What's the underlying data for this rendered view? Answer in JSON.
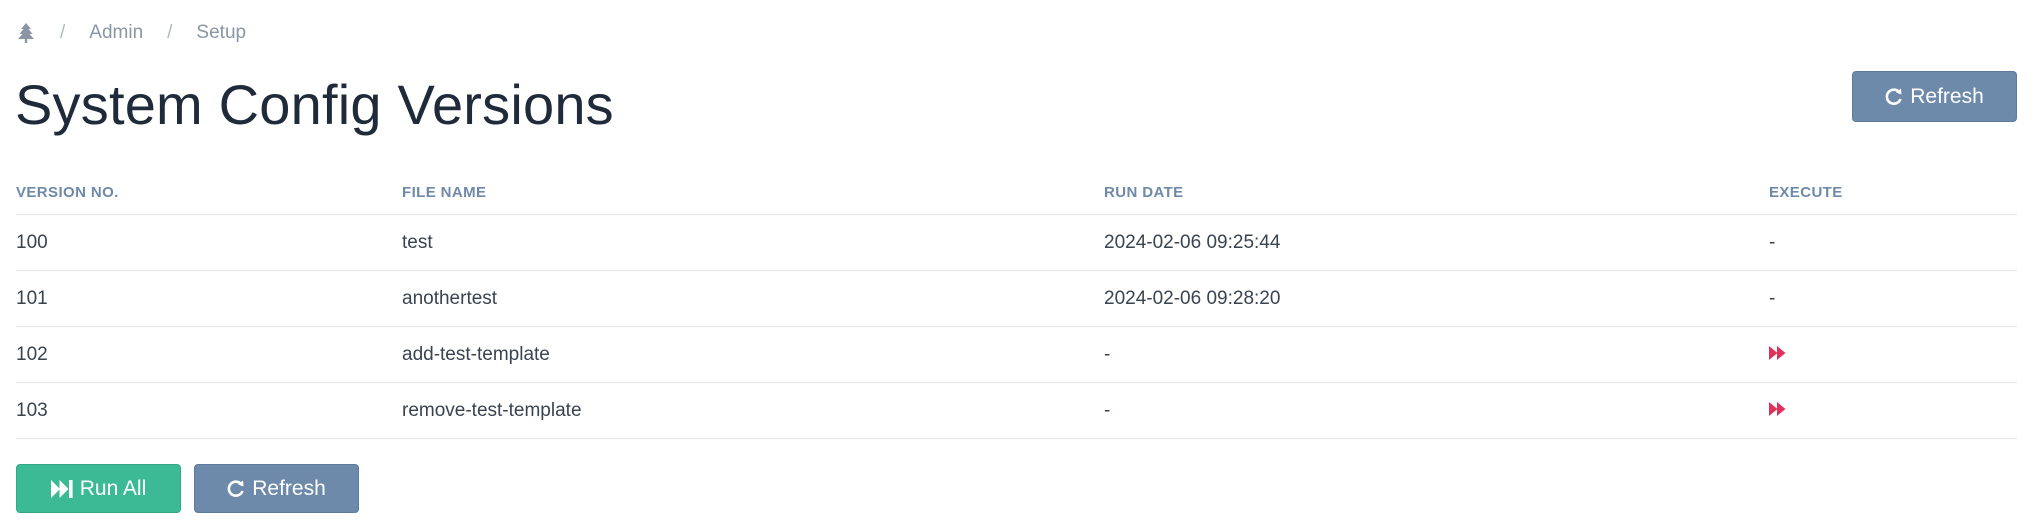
{
  "breadcrumb": {
    "home_icon": "tree-icon",
    "items": [
      "Admin",
      "Setup"
    ],
    "separator": "/"
  },
  "page_title": "System Config Versions",
  "header_refresh_label": "Refresh",
  "table": {
    "columns": [
      "VERSION NO.",
      "FILE NAME",
      "RUN DATE",
      "EXECUTE"
    ],
    "rows": [
      {
        "version": "100",
        "file": "test",
        "run_date": "2024-02-06 09:25:44",
        "execute": "-"
      },
      {
        "version": "101",
        "file": "anothertest",
        "run_date": "2024-02-06 09:28:20",
        "execute": "-"
      },
      {
        "version": "102",
        "file": "add-test-template",
        "run_date": "-",
        "execute_icon": "fast-forward-icon"
      },
      {
        "version": "103",
        "file": "remove-test-template",
        "run_date": "-",
        "execute_icon": "fast-forward-icon"
      }
    ]
  },
  "footer": {
    "run_all_label": "Run All",
    "refresh_label": "Refresh"
  },
  "colors": {
    "gray_button": "#6e8aab",
    "green_button": "#3cb995",
    "execute_icon": "#e0315a",
    "header_text": "#6f89a8"
  }
}
